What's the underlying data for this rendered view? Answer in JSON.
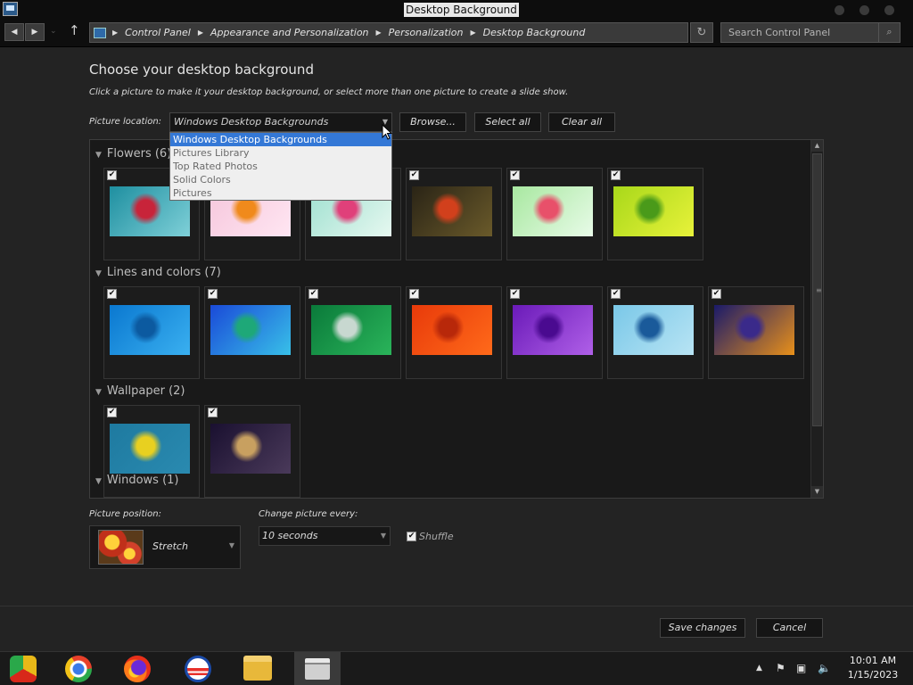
{
  "window": {
    "title": "Desktop Background"
  },
  "addressbar": {
    "back_glyph": "◀",
    "forward_glyph": "▶",
    "recent_glyph": "⌄",
    "up_glyph": "↑",
    "breadcrumb": [
      "Control Panel",
      "Appearance and Personalization",
      "Personalization",
      "Desktop Background"
    ],
    "refresh_glyph": "↻",
    "search_placeholder": "Search Control Panel",
    "search_glyph": "⌕"
  },
  "page": {
    "heading": "Choose your desktop background",
    "subtext": "Click a picture to make it your desktop background, or select more than one picture to create a slide show.",
    "location_label": "Picture location:",
    "location_value": "Windows Desktop Backgrounds",
    "browse_label": "Browse...",
    "select_all_label": "Select all",
    "clear_all_label": "Clear all",
    "dropdown_options": [
      "Windows Desktop Backgrounds",
      "Pictures Library",
      "Top Rated Photos",
      "Solid Colors",
      "Pictures"
    ],
    "dropdown_selected_index": 0
  },
  "gallery": {
    "groups": [
      {
        "label": "Flowers (6)",
        "items": [
          {
            "name": "flower-red-teal",
            "checked": true,
            "colors": [
              "#1e8fa0",
              "#7fd0d8",
              "#c8243a"
            ]
          },
          {
            "name": "flower-orange-pink",
            "checked": true,
            "colors": [
              "#f6c6dc",
              "#ffe6f2",
              "#f08a1c"
            ]
          },
          {
            "name": "flower-pink-mint",
            "checked": true,
            "colors": [
              "#9fe0d0",
              "#e6f8f0",
              "#e0407a"
            ]
          },
          {
            "name": "flower-red-dark",
            "checked": true,
            "colors": [
              "#2a2416",
              "#6a5a2a",
              "#d2401c"
            ]
          },
          {
            "name": "flower-red-green",
            "checked": true,
            "colors": [
              "#a8e8a0",
              "#e8fbe8",
              "#e8506a"
            ]
          },
          {
            "name": "leaf-green",
            "checked": true,
            "colors": [
              "#a8d81a",
              "#e8f23a",
              "#4a9a1a"
            ]
          }
        ]
      },
      {
        "label": "Lines and colors (7)",
        "items": [
          {
            "name": "lines-blue",
            "checked": true,
            "colors": [
              "#0a78d0",
              "#3ab0f0",
              "#0c5aa0"
            ]
          },
          {
            "name": "lines-blue-green",
            "checked": true,
            "colors": [
              "#1a4ad8",
              "#38c0e8",
              "#1ea878"
            ]
          },
          {
            "name": "lines-green",
            "checked": true,
            "colors": [
              "#0a7a3a",
              "#2ab45a",
              "#c8d8d0"
            ]
          },
          {
            "name": "lines-red-orange",
            "checked": true,
            "colors": [
              "#e83a0a",
              "#ff6a1a",
              "#b8280a"
            ]
          },
          {
            "name": "lines-purple",
            "checked": true,
            "colors": [
              "#6a1ab8",
              "#b060e8",
              "#4a0a90"
            ]
          },
          {
            "name": "lines-light-blue",
            "checked": true,
            "colors": [
              "#7ac8e8",
              "#b8e4f4",
              "#1a5a9a"
            ]
          },
          {
            "name": "lines-bars",
            "checked": true,
            "colors": [
              "#1a1a6a",
              "#e8901a",
              "#3a2a8a"
            ]
          }
        ]
      },
      {
        "label": "Wallpaper (2)",
        "items": [
          {
            "name": "chrome-wallpaper",
            "checked": true,
            "colors": [
              "#1e7aa0",
              "#2a8ab0",
              "#e8d020"
            ]
          },
          {
            "name": "blur-wallpaper",
            "checked": true,
            "colors": [
              "#1a1030",
              "#4a3a5a",
              "#c8a060"
            ]
          }
        ]
      },
      {
        "label": "Windows (1)",
        "items": []
      }
    ]
  },
  "options": {
    "position_label": "Picture position:",
    "position_value": "Stretch",
    "change_label": "Change picture every:",
    "change_value": "10 seconds",
    "shuffle_label": "Shuffle",
    "shuffle_checked": true,
    "check_glyph": "✔"
  },
  "footer": {
    "save_label": "Save changes",
    "cancel_label": "Cancel"
  },
  "taskbar": {
    "apps": [
      "chrome-canary",
      "chrome",
      "firefox",
      "obama-app",
      "file-explorer",
      "control-panel"
    ],
    "time": "10:01 AM",
    "date": "1/15/2023"
  }
}
